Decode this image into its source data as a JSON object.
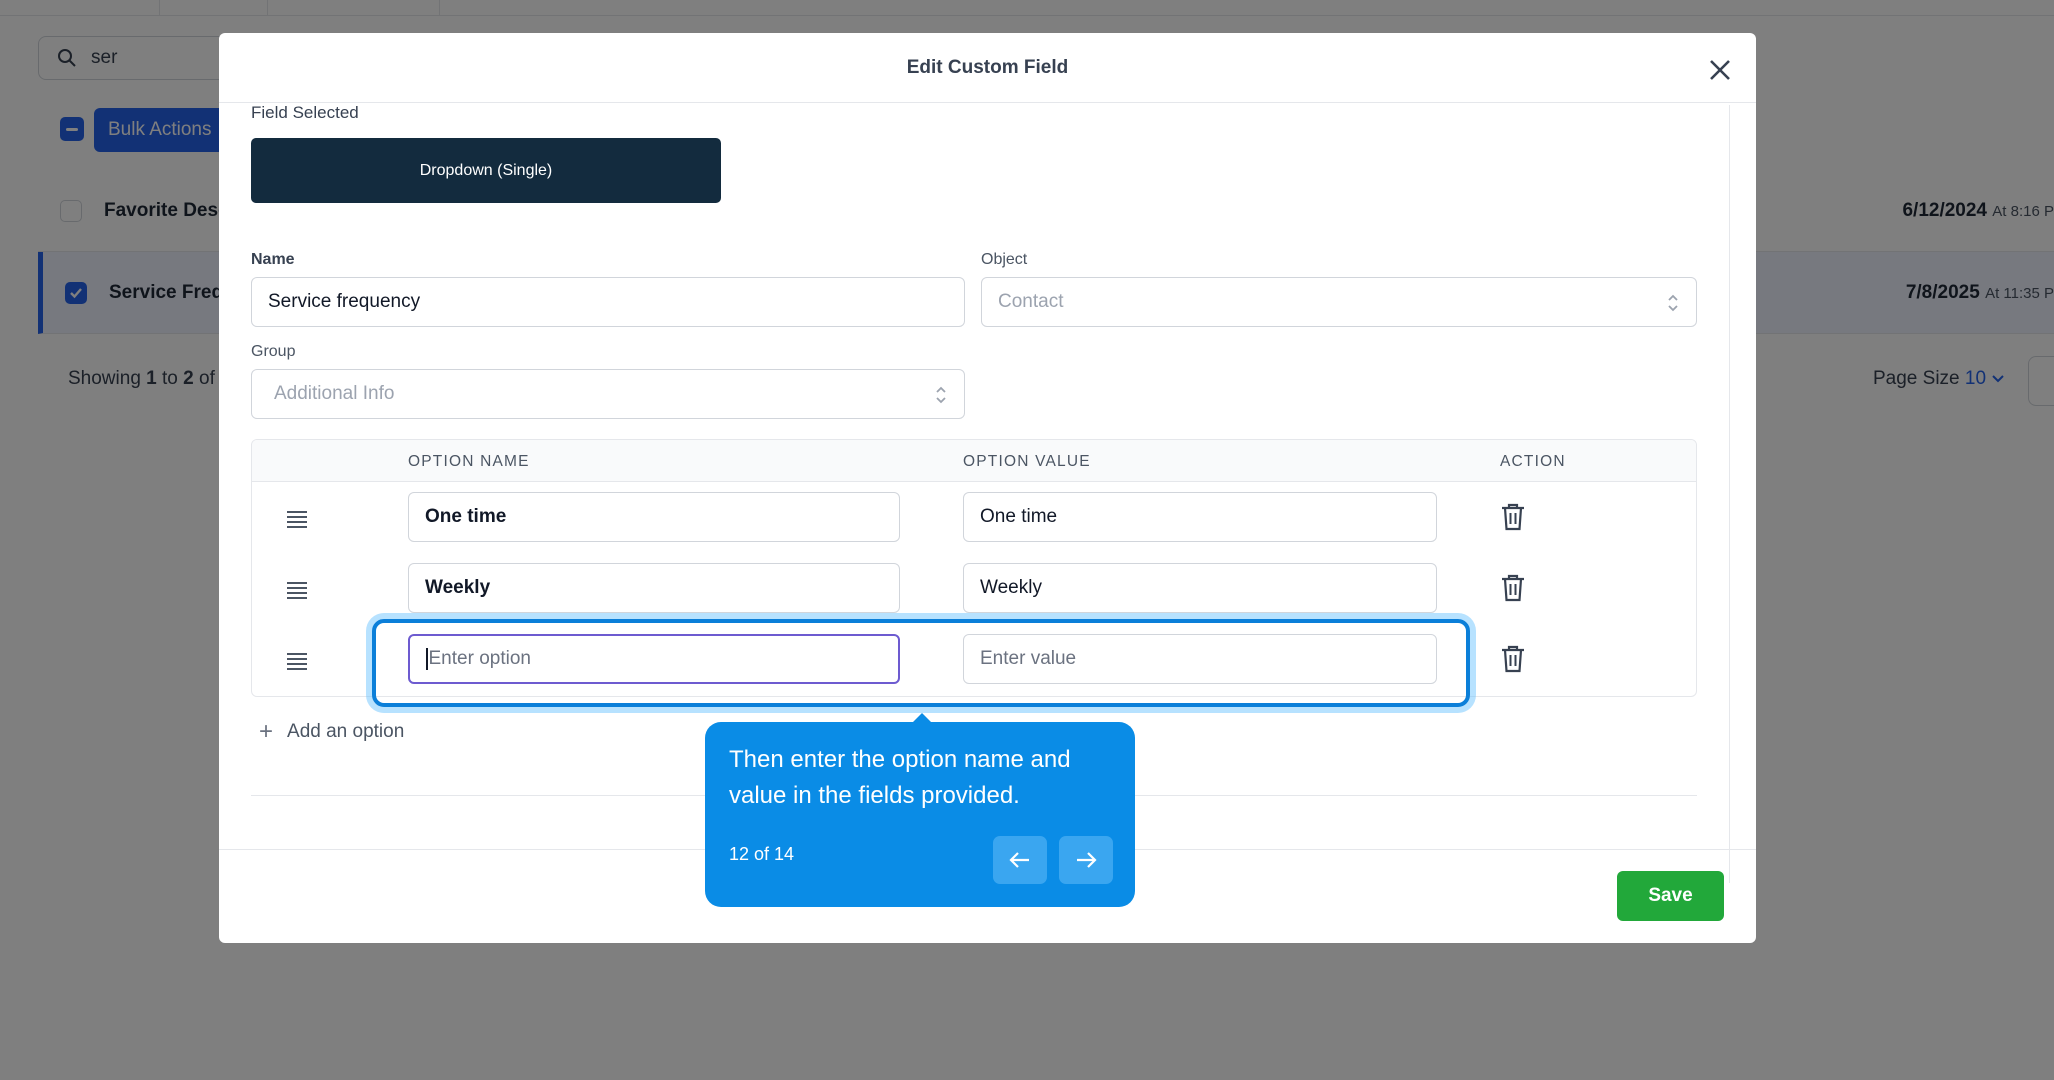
{
  "background": {
    "search_value": "ser",
    "bulk_label": "Bulk Actions",
    "rows": [
      {
        "name": "Favorite Dese",
        "date": "6/12/2024",
        "time": "At 8:16 P",
        "checked": false
      },
      {
        "name": "Service Freq",
        "date": "7/8/2025",
        "time": "At 11:35 P",
        "checked": true
      }
    ],
    "showing_prefix": "Showing ",
    "showing_start": "1",
    "showing_mid": " to ",
    "showing_end": "2",
    "showing_suffix": " of",
    "page_size_label": "Page Size ",
    "page_size_value": "10"
  },
  "modal": {
    "title": "Edit Custom Field",
    "field_selected_label": "Field Selected",
    "field_type": "Dropdown (Single)",
    "name_label": "Name",
    "name_value": "Service frequency",
    "object_label": "Object",
    "object_value": "Contact",
    "group_label": "Group",
    "group_value": "Additional Info",
    "table": {
      "headers": {
        "option_name": "OPTION NAME",
        "option_value": "OPTION VALUE",
        "action": "ACTION"
      },
      "rows": [
        {
          "option_name": "One time",
          "option_value": "One time"
        },
        {
          "option_name": "Weekly",
          "option_value": "Weekly"
        }
      ],
      "new_row": {
        "name_placeholder": "Enter option",
        "value_placeholder": "Enter value"
      }
    },
    "add_option_label": "Add an option",
    "save_label": "Save"
  },
  "tooltip": {
    "text": "Then enter the option name and value in the fields provided.",
    "step": "12 of 14"
  },
  "colors": {
    "primary": "#2563eb",
    "field_type_bg": "#132b3e",
    "save": "#22a83a",
    "tooltip": "#0a8ce6",
    "focus": "#6d5bd0"
  }
}
